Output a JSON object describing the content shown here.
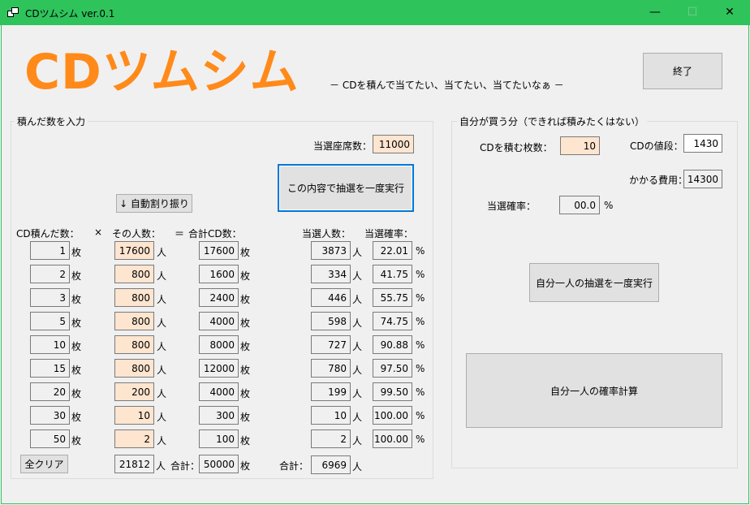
{
  "window": {
    "title": "CDツムシム ver.0.1",
    "minimize": "—",
    "maximize": "☐",
    "close": "✕"
  },
  "header": {
    "logo": "CDツムシム",
    "tagline": "－ CDを積んで当てたい、当てたい、当てたいなぁ －",
    "exit_button": "終了"
  },
  "left": {
    "group_label": "積んだ数を入力",
    "seats_label": "当選座席数：",
    "seats_value": "11000",
    "run_button": "この内容で抽選を一度実行",
    "auto_button": "↓ 自動割り振り",
    "headers": {
      "cd_count": "CD積んだ数：",
      "times": "×",
      "people": "その人数：",
      "equals": "＝",
      "total_cd": "合計CD数：",
      "winners": "当選人数：",
      "rate": "当選確率："
    },
    "unit_mai": "枚",
    "unit_nin": "人",
    "unit_pct": "%",
    "rows": [
      {
        "cd": "1",
        "people": "17600",
        "total": "17600",
        "winners": "3873",
        "rate": "22.01"
      },
      {
        "cd": "2",
        "people": "800",
        "total": "1600",
        "winners": "334",
        "rate": "41.75"
      },
      {
        "cd": "3",
        "people": "800",
        "total": "2400",
        "winners": "446",
        "rate": "55.75"
      },
      {
        "cd": "5",
        "people": "800",
        "total": "4000",
        "winners": "598",
        "rate": "74.75"
      },
      {
        "cd": "10",
        "people": "800",
        "total": "8000",
        "winners": "727",
        "rate": "90.88"
      },
      {
        "cd": "15",
        "people": "800",
        "total": "12000",
        "winners": "780",
        "rate": "97.50"
      },
      {
        "cd": "20",
        "people": "200",
        "total": "4000",
        "winners": "199",
        "rate": "99.50"
      },
      {
        "cd": "30",
        "people": "10",
        "total": "300",
        "winners": "10",
        "rate": "100.00"
      },
      {
        "cd": "50",
        "people": "2",
        "total": "100",
        "winners": "2",
        "rate": "100.00"
      }
    ],
    "clear_button": "全クリア",
    "people_total": "21812",
    "sum_label": "合計：",
    "cd_total": "50000",
    "winners_total_label": "合計：",
    "winners_total": "6969"
  },
  "right": {
    "group_label": "自分が買う分（できれば積みたくはない）",
    "cd_count_label": "CDを積む枚数：",
    "cd_count_value": "10",
    "price_label": "CDの値段：",
    "price_value": "1430",
    "cost_label": "かかる費用：",
    "cost_value": "14300",
    "rate_label": "当選確率：",
    "rate_value": "00.0",
    "rate_unit": "%",
    "run_once_button": "自分一人の抽選を一度実行",
    "calc_button": "自分一人の確率計算"
  }
}
